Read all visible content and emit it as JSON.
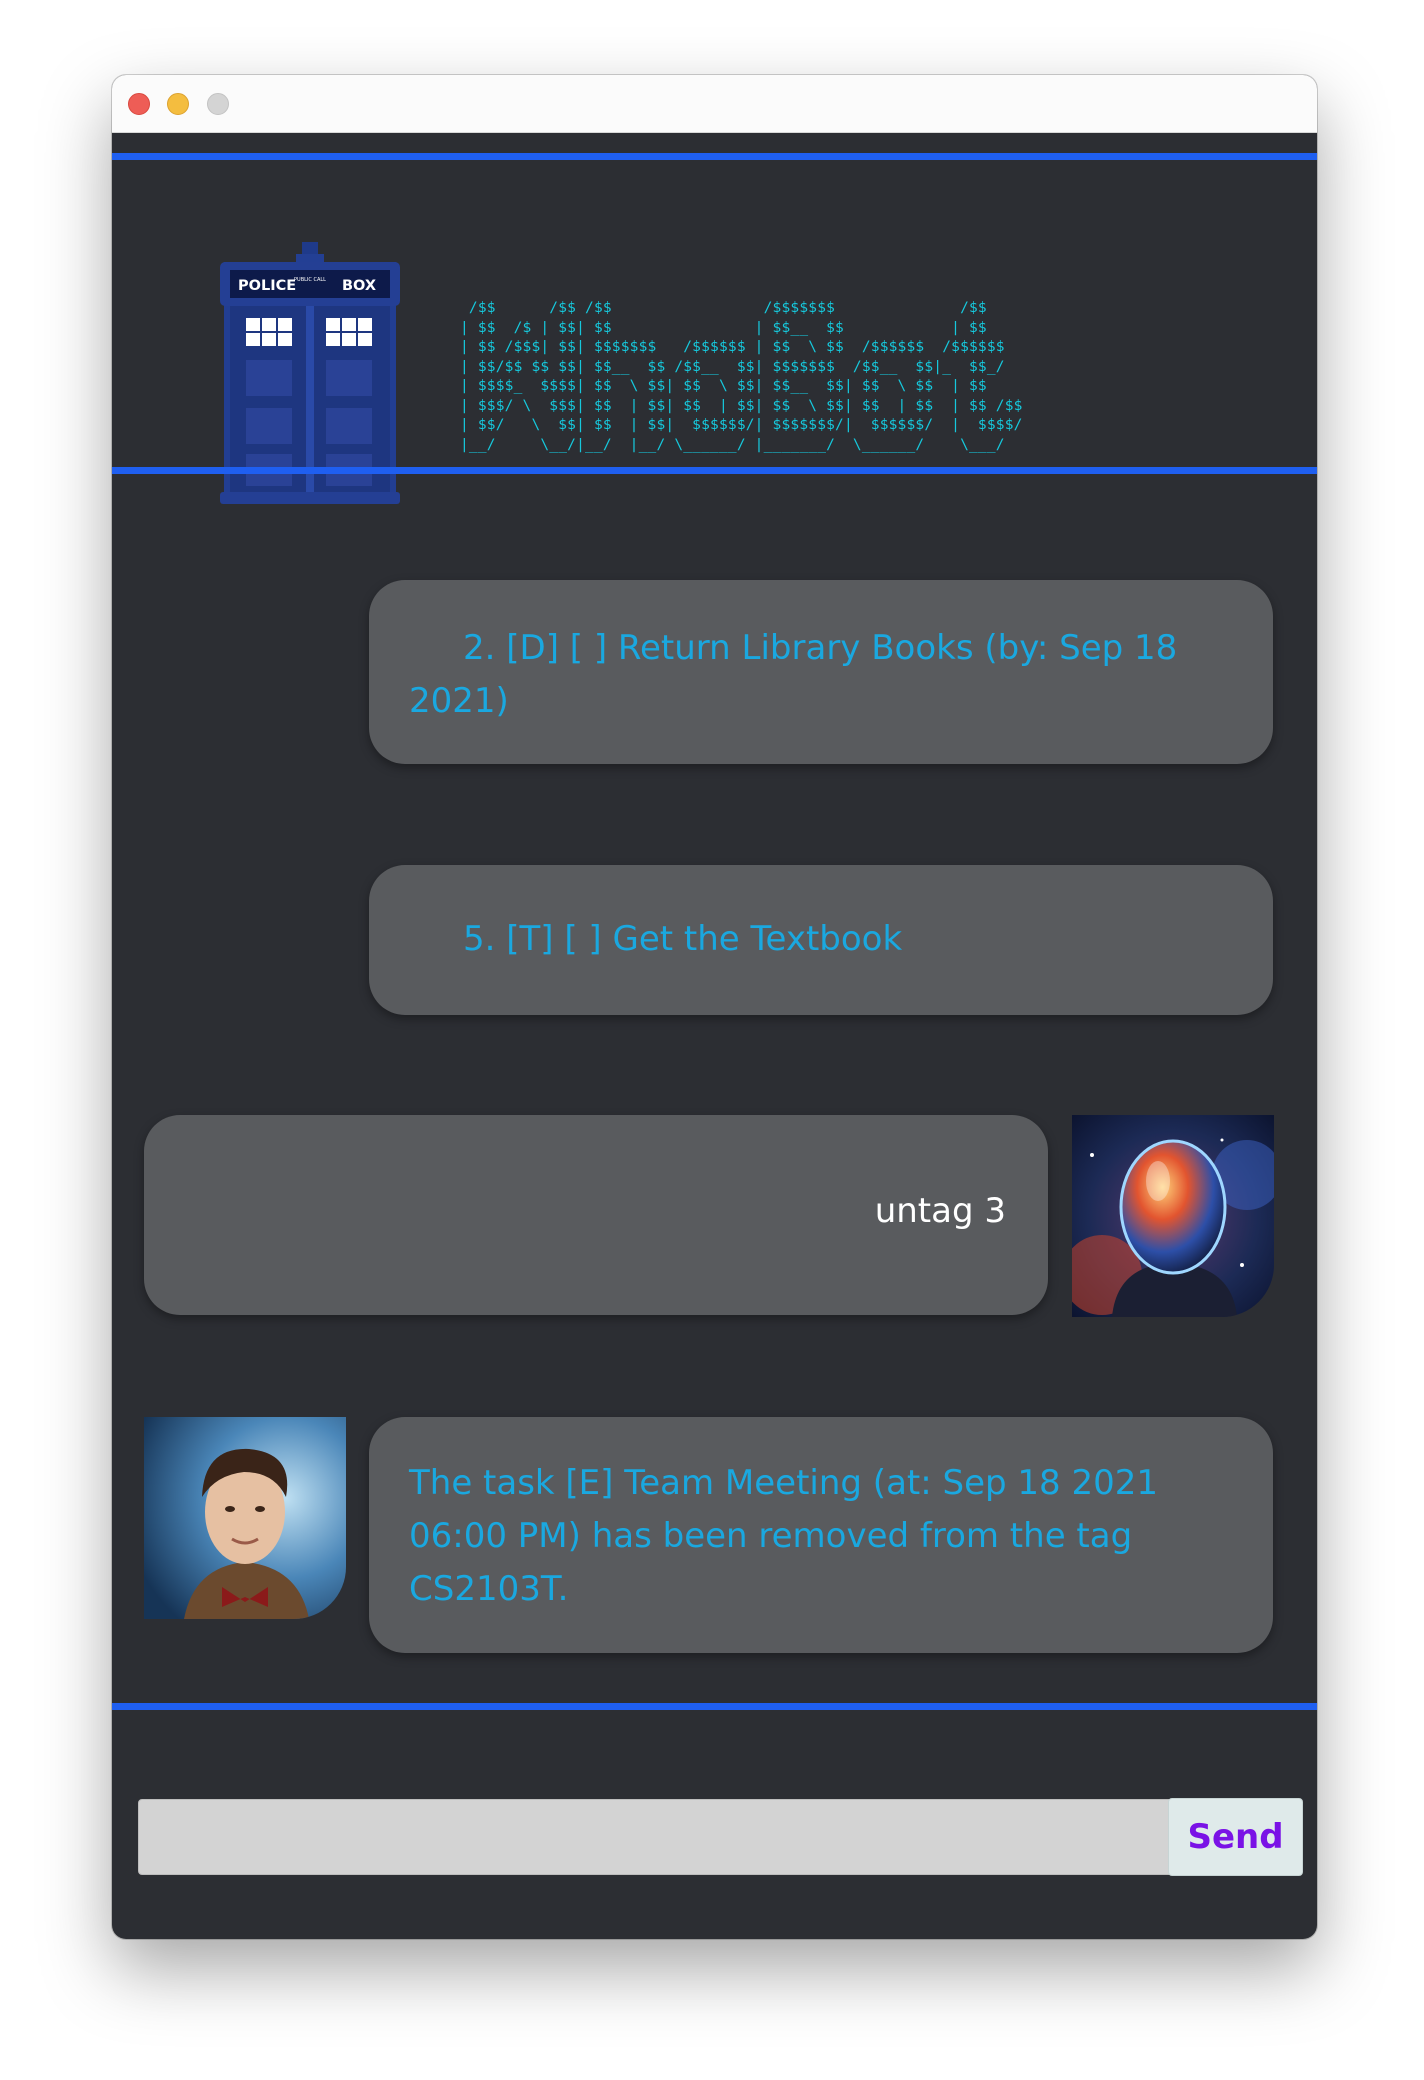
{
  "window": {
    "controls": [
      "close",
      "minimize",
      "maximize"
    ]
  },
  "header": {
    "logo_icon": "tardis-police-box-icon",
    "logo_text_top": "POLICE",
    "logo_text_small": "PUBLIC CALL",
    "logo_text_right": "BOX",
    "ascii_banner": " /$$      /$$ /$$                 /$$$$$$$              /$$    \n| $$  /$ | $$| $$                | $$__  $$            | $$    \n| $$ /$$$| $$| $$$$$$$   /$$$$$$ | $$  \\ $$  /$$$$$$  /$$$$$$  \n| $$/$$ $$ $$| $$__  $$ /$$__  $$| $$$$$$$  /$$__  $$|_  $$_/  \n| $$$$_  $$$$| $$  \\ $$| $$  \\ $$| $$__  $$| $$  \\ $$  | $$    \n| $$$/ \\  $$$| $$  | $$| $$  | $$| $$  \\ $$| $$  | $$  | $$ /$$\n| $$/   \\  $$| $$  | $$|  $$$$$$/| $$$$$$$/|  $$$$$$/  |  $$$$/\n|__/     \\__/|__/  |__/ \\______/ |_______/  \\______/    \\___/  "
  },
  "messages": [
    {
      "sender": "bot",
      "text": "2. [D] [ ] Return Library Books (by: Sep 18 2021)"
    },
    {
      "sender": "bot",
      "text": "5. [T] [ ] Get the Textbook"
    },
    {
      "sender": "user",
      "text": "untag 3",
      "avatar": "user-avatar-cosmic-helmet"
    },
    {
      "sender": "bot",
      "text": "The task [E] Team Meeting (at: Sep 18 2021 06:00 PM) has been removed from the tag CS2103T.",
      "avatar": "bot-avatar-doctor"
    }
  ],
  "input": {
    "value": "",
    "placeholder": "",
    "send_label": "Send"
  },
  "colors": {
    "background": "#2c2e33",
    "accent_line": "#1f5ff0",
    "bubble": "#595b5e",
    "bot_text": "#1aa8e0",
    "user_text": "#ffffff",
    "ascii": "#16c8dc",
    "send_text": "#7a12e6"
  }
}
